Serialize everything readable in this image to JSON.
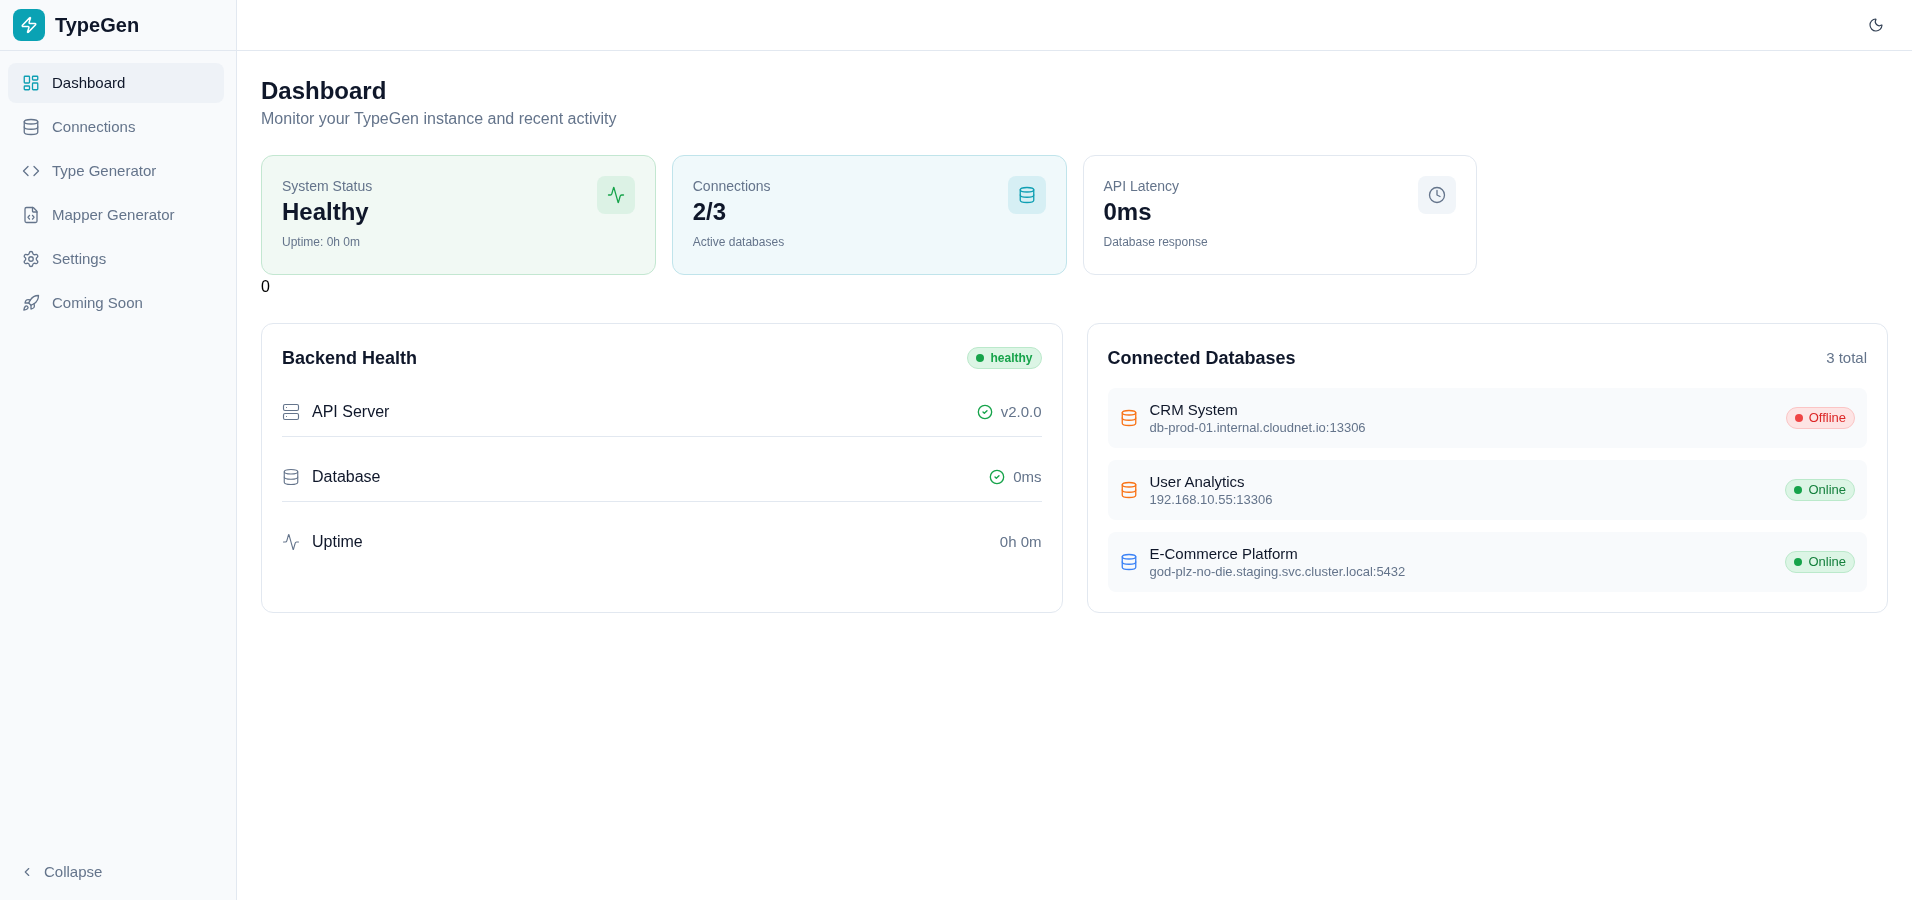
{
  "sidebar": {
    "brand": "TypeGen",
    "items": [
      {
        "label": "Dashboard",
        "selected": true
      },
      {
        "label": "Connections",
        "selected": false
      },
      {
        "label": "Type Generator",
        "selected": false
      },
      {
        "label": "Mapper Generator",
        "selected": false
      },
      {
        "label": "Settings",
        "selected": false
      },
      {
        "label": "Coming Soon",
        "selected": false
      }
    ],
    "collapse": "Collapse"
  },
  "page": {
    "title": "Dashboard",
    "subtitle": "Monitor your TypeGen instance and recent activity"
  },
  "stat_cards": [
    {
      "kind": "status",
      "label": "System Status",
      "value": "Healthy",
      "caption": "Uptime: 0h 0m"
    },
    {
      "kind": "connections",
      "label": "Connections",
      "value": "2/3",
      "caption": "Active databases"
    },
    {
      "kind": "latency",
      "label": "API Latency",
      "value": "0ms",
      "caption": "Database response"
    }
  ],
  "stray_value": "0",
  "backend_health": {
    "title": "Backend Health",
    "badge": "healthy",
    "rows": [
      {
        "label": "API Server",
        "value": "v2.0.0",
        "ok": true
      },
      {
        "label": "Database",
        "value": "0ms",
        "ok": true
      },
      {
        "label": "Uptime",
        "value": "0h 0m",
        "ok": false
      }
    ]
  },
  "connected_databases": {
    "title": "Connected Databases",
    "count": "3 total",
    "items": [
      {
        "name": "CRM System",
        "host": "db-prod-01.internal.cloudnet.io:13306",
        "color": "#f97316",
        "status": "Offline",
        "online": false
      },
      {
        "name": "User Analytics",
        "host": "192.168.10.55:13306",
        "color": "#f97316",
        "status": "Online",
        "online": true
      },
      {
        "name": "E-Commerce Platform",
        "host": "god-plz-no-die.staging.svc.cluster.local:5432",
        "color": "#3b82f6",
        "status": "Online",
        "online": true
      }
    ]
  }
}
